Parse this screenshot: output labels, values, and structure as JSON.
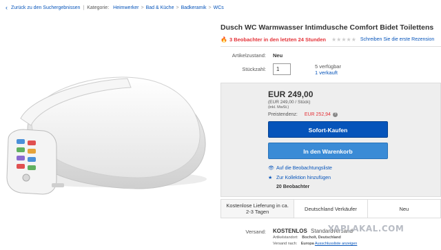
{
  "breadcrumb": {
    "back_label": "Zurück zu den Suchergebnissen",
    "category_label": "Kategorie:",
    "path": [
      "Heimwerker",
      "Bad & Küche",
      "Badkeramik",
      "WCs"
    ]
  },
  "item": {
    "title": "Dusch WC Warmwasser Intimdusche Comfort Bidet Toilettens",
    "watchers_text": "3 Beobachter in den letzten 24 Stunden",
    "rating_stars": "★★★★★",
    "review_link": "Schreiben Sie die erste Rezension"
  },
  "condition": {
    "label": "Artikelzustand:",
    "value": "Neu"
  },
  "quantity": {
    "label": "Stückzahl:",
    "value": "1",
    "available": "5 verfügbar",
    "sold": "1 verkauft"
  },
  "pricing": {
    "price": "EUR 249,00",
    "unit_price": "(EUR 249,00 / Stück)",
    "vat": "(inkl. MwSt.)",
    "rrp_label": "Preistendenz:",
    "rrp_value": "EUR 252,94",
    "help_icon": "?"
  },
  "buttons": {
    "buy_now": "Sofort-Kaufen",
    "add_to_cart": "In den Warenkorb"
  },
  "links": {
    "watchlist": "Auf die Beobachtungsliste",
    "collection": "Zur Kollektion hinzufügen",
    "watch_count": "20 Beobachter"
  },
  "features": [
    "Kostenlose Lieferung in ca. 2-3 Tagen",
    "Deutschland Verkäufer",
    "Neu"
  ],
  "shipping": {
    "label": "Versand:",
    "value": "KOSTENLOS",
    "method": "Standardversand",
    "location_label": "Artikelstandort:",
    "location": "Bocholt, Deutschland",
    "ship_to_label": "Versand nach:",
    "ship_to": "Europa",
    "exclusions_link": "Ausschlussliste anzeigen"
  },
  "watermark": "YAPLAKAL.COM",
  "colors": {
    "link": "#0654ba",
    "buy_button": "#0654ba",
    "cart_button": "#3a8bd6",
    "alert": "#e43137"
  }
}
